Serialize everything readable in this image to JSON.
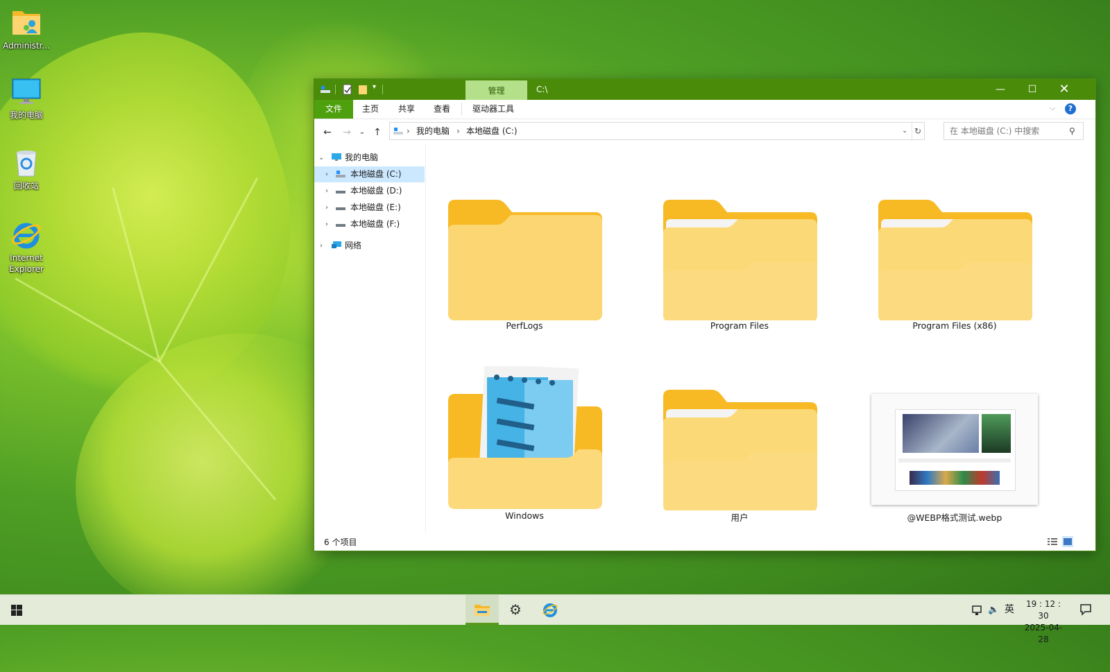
{
  "desktop": {
    "icons": [
      {
        "label": "Administr..."
      },
      {
        "label": "我的电脑"
      },
      {
        "label": "回收站"
      },
      {
        "label_line1": "Internet",
        "label_line2": "Explorer"
      }
    ]
  },
  "window": {
    "title": "C:\\",
    "context_tab": "管理",
    "ribbon_tabs": [
      "文件",
      "主页",
      "共享",
      "查看",
      "驱动器工具"
    ],
    "breadcrumb": [
      "我的电脑",
      "本地磁盘 (C:)"
    ],
    "search_placeholder": "在 本地磁盘 (C:) 中搜索",
    "nav_tree": {
      "root": "我的电脑",
      "drives": [
        "本地磁盘 (C:)",
        "本地磁盘 (D:)",
        "本地磁盘 (E:)",
        "本地磁盘 (F:)"
      ],
      "network": "网络"
    },
    "items": [
      {
        "name": "PerfLogs",
        "type": "folder-empty"
      },
      {
        "name": "Program Files",
        "type": "folder-full"
      },
      {
        "name": "Program Files (x86)",
        "type": "folder-full"
      },
      {
        "name": "Windows",
        "type": "folder-windows"
      },
      {
        "name": "用户",
        "type": "folder-full"
      },
      {
        "name": "@WEBP格式测试.webp",
        "type": "image-thumbnail"
      }
    ],
    "status": "6 个项目"
  },
  "taskbar": {
    "ime": "英",
    "time": "19 : 12 : 30",
    "date": "2025-04-28"
  },
  "colors": {
    "accent": "#4a8c0a",
    "context_tab_bg": "#b4e08a",
    "selection": "#cce8ff",
    "folder_back": "#f7b924",
    "folder_front": "#fbd672"
  }
}
